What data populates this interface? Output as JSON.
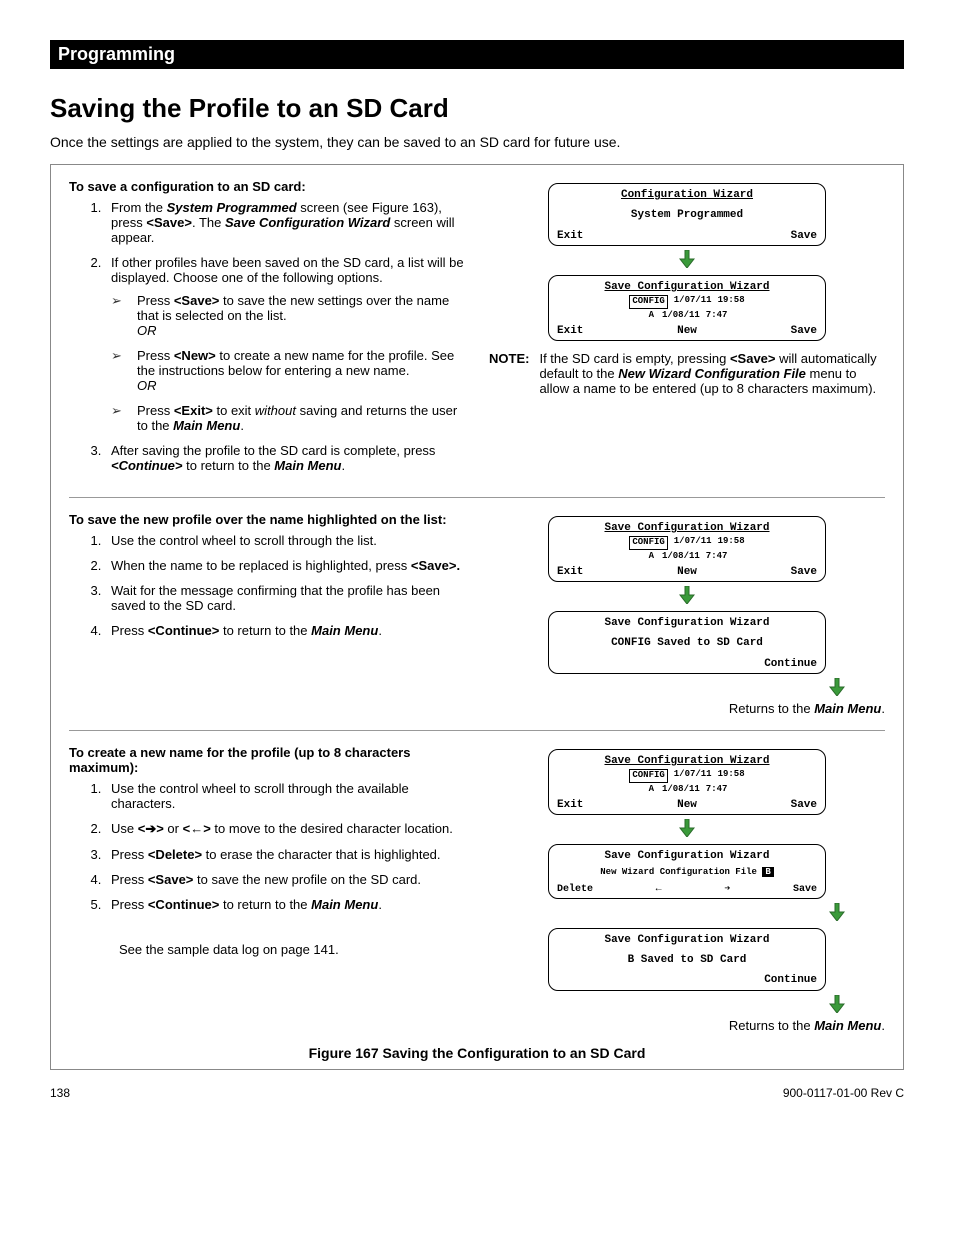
{
  "header": {
    "section": "Programming"
  },
  "title": "Saving the Profile to an SD Card",
  "intro": "Once the settings are applied to the system, they can be saved to an SD card for future use.",
  "sec1": {
    "heading": "To save a configuration to an SD card:",
    "step1_a": "From the ",
    "step1_b": "System Programmed",
    "step1_c": " screen (see Figure 163), press ",
    "step1_d": "<Save>",
    "step1_e": ".  The ",
    "step1_f": "Save Configuration Wizard",
    "step1_g": " screen will appear.",
    "step2": "If other profiles have been saved on the SD card, a list will be displayed.  Choose one of the following options.",
    "sub1_a": "Press ",
    "sub1_b": "<Save>",
    "sub1_c": " to save the new settings over the name that is selected on the list.",
    "or": "OR",
    "sub2_a": "Press ",
    "sub2_b": "<New>",
    "sub2_c": " to create a new name for the profile.  See the instructions below for entering a new name.",
    "sub3_a": "Press ",
    "sub3_b": "<Exit>",
    "sub3_c": " to exit ",
    "sub3_d": "without",
    "sub3_e": " saving and returns the user to the ",
    "sub3_f": "Main Menu",
    "sub3_g": ".",
    "step3_a": "After saving the profile to the SD card is complete, press ",
    "step3_b": "<Continue>",
    "step3_c": " to return to the ",
    "step3_d": "Main Menu",
    "step3_e": "."
  },
  "lcd1": {
    "title": "Configuration Wizard",
    "status": "System Programmed",
    "btn_left": "Exit",
    "btn_right": "Save"
  },
  "lcd2": {
    "title": "Save Configuration Wizard",
    "r1c1": "CONFIG",
    "r1c2": "1/07/11",
    "r1c3": "19:58",
    "r2c1": "A",
    "r2c2": "1/08/11",
    "r2c3": "7:47",
    "btn_l": "Exit",
    "btn_m": "New",
    "btn_r": "Save"
  },
  "note": {
    "label": "NOTE:",
    "t1": "If the SD card is empty, pressing ",
    "t2": "<Save>",
    "t3": " will automatically default to the ",
    "t4": "New Wizard Configuration File",
    "t5": " menu to allow a name to be entered (up to 8 characters maximum)."
  },
  "sec2": {
    "heading": "To save the new profile over the name highlighted on the list:",
    "s1": "Use the control wheel to scroll through the list.",
    "s2_a": "When the name to be replaced is highlighted, press ",
    "s2_b": "<Save>.",
    "s3": "Wait for the message confirming that the profile has been saved to the SD card.",
    "s4_a": "Press ",
    "s4_b": "<Continue>",
    "s4_c": " to return to the ",
    "s4_d": "Main Menu",
    "s4_e": "."
  },
  "lcd3": {
    "title": "Save Configuration Wizard",
    "status": "CONFIG Saved to SD Card",
    "btn": "Continue"
  },
  "returns_a": "Returns to the ",
  "returns_b": "Main Menu",
  "returns_c": ".",
  "sec3": {
    "heading": "To create a new name for the profile (up to 8 characters maximum):",
    "s1": "Use the control wheel to scroll through the available characters.",
    "s2_a": "Use  ",
    "s2_b": "<➔>",
    "s2_c": " or ",
    "s2_d": "<←>",
    "s2_e": " to move to the desired character location.",
    "s3_a": "Press ",
    "s3_b": "<Delete>",
    "s3_c": " to erase the character that is highlighted.",
    "s4_a": "Press ",
    "s4_b": "<Save>",
    "s4_c": " to save the new profile on the SD card.",
    "s5_a": "Press ",
    "s5_b": "<Continue>",
    "s5_c": " to return to the ",
    "s5_d": "Main Menu",
    "s5_e": ".",
    "sample": "See the sample data log on page 141."
  },
  "lcd4": {
    "title": "Save Configuration Wizard",
    "file_label": "New Wizard Configuration File ",
    "file_cursor": "B",
    "btn1": "Delete",
    "btn2": "←",
    "btn3": "➔",
    "btn4": "Save"
  },
  "lcd5": {
    "title": "Save Configuration Wizard",
    "status": "B Saved to SD Card",
    "btn": "Continue"
  },
  "figure": "Figure 167     Saving the Configuration to an SD Card",
  "footer": {
    "page": "138",
    "rev": "900-0117-01-00 Rev C"
  }
}
